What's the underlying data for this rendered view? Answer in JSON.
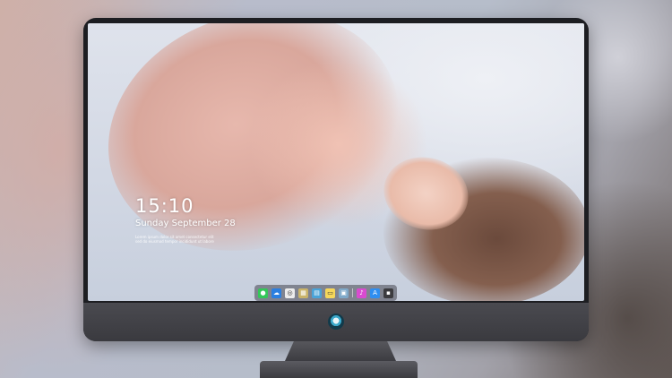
{
  "lock_screen": {
    "time": "15:10",
    "date": "Sunday September 28",
    "note_line1": "Lorem ipsum dolor sit amet consectetur elit",
    "note_line2": "sed do eiusmod tempor incididunt ut labore"
  },
  "dock": {
    "icons": [
      {
        "name": "messages-icon",
        "glyph": "●",
        "color": "#34c759"
      },
      {
        "name": "weather-icon",
        "glyph": "☁",
        "color": "#2b7fe0"
      },
      {
        "name": "safari-icon",
        "glyph": "◎",
        "color": "#ececec"
      },
      {
        "name": "photos-icon",
        "glyph": "▦",
        "color": "#c9b36a"
      },
      {
        "name": "clapper-icon",
        "glyph": "▤",
        "color": "#4aa3d8"
      },
      {
        "name": "notes-icon",
        "glyph": "▭",
        "color": "#f6d75a"
      },
      {
        "name": "preview-icon",
        "glyph": "▣",
        "color": "#7fa9c9"
      },
      {
        "name": "music-icon",
        "glyph": "♪",
        "color": "#d94bd0"
      },
      {
        "name": "app-store-icon",
        "glyph": "A",
        "color": "#2f8ef0"
      },
      {
        "name": "terminal-icon",
        "glyph": "▪",
        "color": "#3b3b3f"
      }
    ]
  },
  "colors": {
    "monitor_bezel": "#1d1e22",
    "chin": "#3f3f45",
    "text": "#ffffff"
  }
}
